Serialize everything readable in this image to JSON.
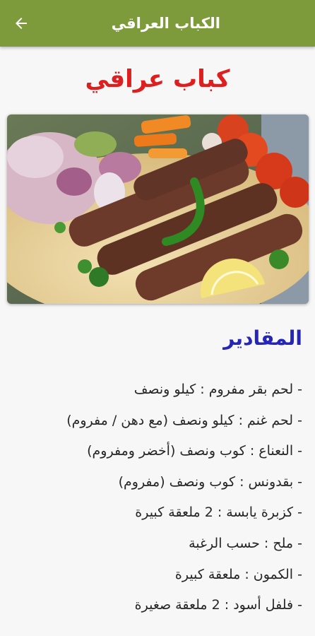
{
  "appbar": {
    "title": "الكباب العراقي",
    "back_icon": "arrow-left-icon"
  },
  "recipe": {
    "title": "كباب عراقي",
    "image_alt": "kebab-photo"
  },
  "ingredients_section": {
    "heading": "المقادير",
    "items": [
      "- لحم بقر مفروم : كيلو ونصف",
      "- لحم غنم : كيلو ونصف (مع دهن / مفروم)",
      "- النعناع : كوب ونصف (أخضر ومفروم)",
      "- بقدونس : كوب ونصف (مفروم)",
      "- كزبرة يابسة : 2 ملعقة كبيرة",
      "- ملح : حسب الرغبة",
      "- الكمون : ملعقة كبيرة",
      "- فلفل أسود : 2 ملعقة صغيرة"
    ]
  },
  "colors": {
    "appbar": "#7e9b3b",
    "title": "#dd1f1f",
    "heading": "#2525b8"
  }
}
